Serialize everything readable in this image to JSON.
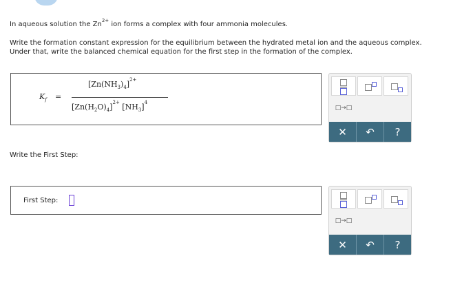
{
  "question": {
    "intro_prefix": "In aqueous solution the Zn",
    "intro_charge": "2+",
    "intro_suffix": " ion forms a complex with four ammonia molecules.",
    "instr_line1": "Write the formation constant expression for the equilibrium between the hydrated metal ion and the aqueous complex.",
    "instr_line2": "Under that, write the balanced chemical equation for the first step in the formation of the complex."
  },
  "kf_panel": {
    "symbol": "K",
    "symbol_sub": "f",
    "equals": "=",
    "numerator": {
      "metal": "Zn",
      "ligand": "NH",
      "ligand_sub": "3",
      "count": "4",
      "charge": "2+"
    },
    "denominator": {
      "metal": "Zn",
      "ligand": "H",
      "ligand_sub": "2",
      "ligand_tail": "O",
      "count": "4",
      "charge": "2+",
      "second": "NH",
      "second_sub": "3",
      "second_power": "4"
    }
  },
  "first_step": {
    "heading": "Write the First Step:",
    "label": "First Step:"
  },
  "toolbar": {
    "arrow_label": "□→□",
    "clear_label": "✕",
    "undo_label": "↶",
    "help_label": "?"
  },
  "colors": {
    "accent": "#3d6b80",
    "cursor": "#6a3fd6",
    "placeholder_blue": "#5a62d8"
  }
}
